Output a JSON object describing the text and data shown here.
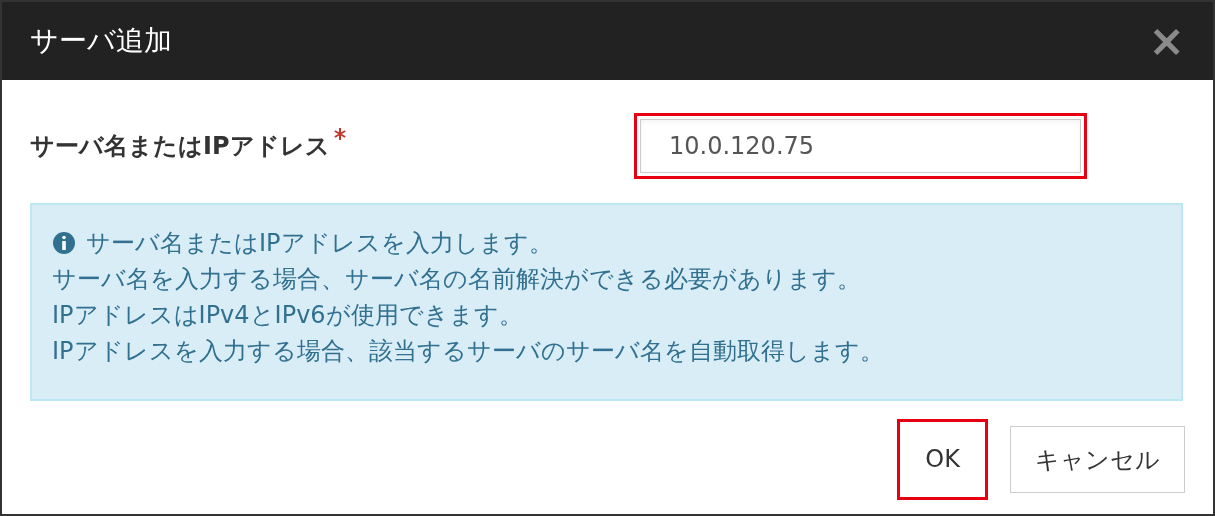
{
  "dialog": {
    "title": "サーバ追加",
    "close": "×"
  },
  "field": {
    "label": "サーバ名またはIPアドレス",
    "required": true,
    "value": "10.0.120.75",
    "highlighted": true
  },
  "info": {
    "lines": [
      "サーバ名またはIPアドレスを入力します。",
      "サーバ名を入力する場合、サーバ名の名前解決ができる必要があります。",
      "IPアドレスはIPv4とIPv6が使用できます。",
      "IPアドレスを入力する場合、該当するサーバのサーバ名を自動取得します。"
    ]
  },
  "buttons": [
    {
      "label": "OK",
      "highlighted": true
    },
    {
      "label": "キャンセル",
      "highlighted": false
    }
  ]
}
